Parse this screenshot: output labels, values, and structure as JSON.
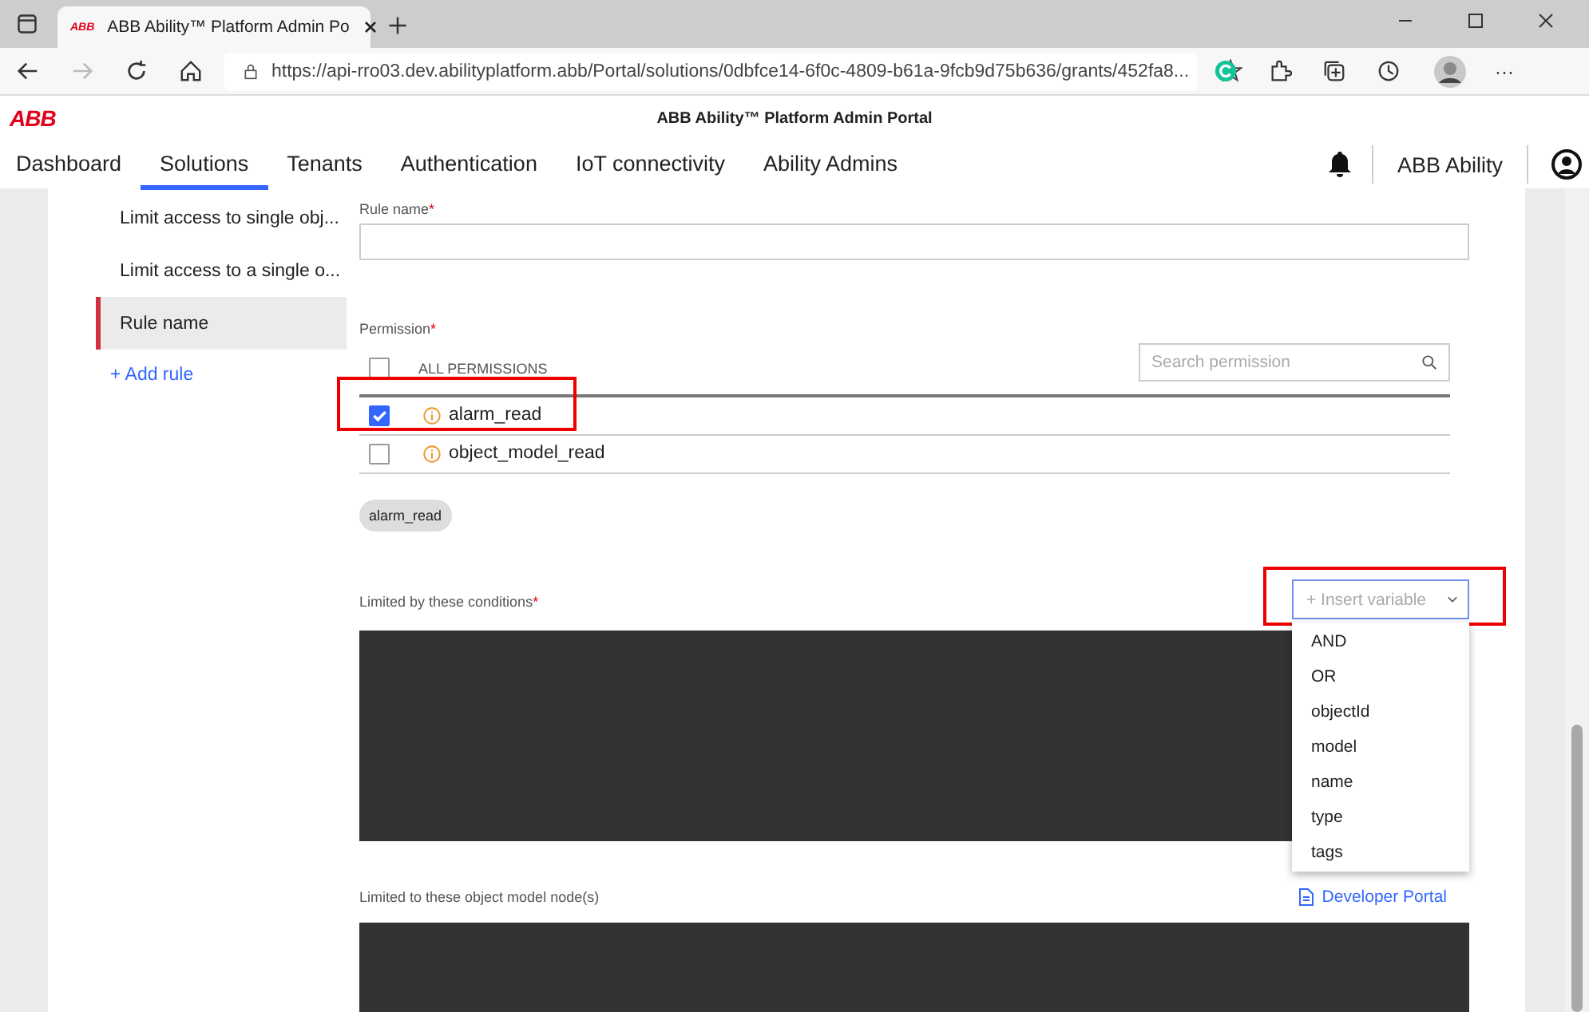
{
  "browser": {
    "tab_title": "ABB Ability™ Platform Admin Po",
    "tab_logo": "ABB",
    "url": "https://api-rro03.dev.abilityplatform.abb/Portal/solutions/0dbfce14-6f0c-4809-b61a-9fcb9d75b636/grants/452fa8...",
    "menu": "···"
  },
  "header": {
    "logo": "ABB",
    "title": "ABB Ability™ Platform Admin Portal",
    "tenant": "ABB Ability"
  },
  "nav": [
    {
      "label": "Dashboard",
      "selected": false
    },
    {
      "label": "Solutions",
      "selected": true
    },
    {
      "label": "Tenants",
      "selected": false
    },
    {
      "label": "Authentication",
      "selected": false
    },
    {
      "label": "IoT connectivity",
      "selected": false
    },
    {
      "label": "Ability Admins",
      "selected": false
    }
  ],
  "sidebar": {
    "items": [
      {
        "label": "Limit access to single obj...",
        "selected": false
      },
      {
        "label": "Limit access to a single o...",
        "selected": false
      },
      {
        "label": "Rule name",
        "selected": true
      }
    ],
    "add_rule": "+ Add rule"
  },
  "form": {
    "rule_name": {
      "label": "Rule name",
      "required_mark": "*"
    },
    "permission": {
      "label": "Permission",
      "required_mark": "*",
      "search_placeholder": "Search permission",
      "all_label": "ALL PERMISSIONS",
      "all_checked": false,
      "items": [
        {
          "name": "alarm_read",
          "checked": true,
          "highlighted": true
        },
        {
          "name": "object_model_read",
          "checked": false,
          "highlighted": false
        }
      ],
      "chips": [
        "alarm_read"
      ]
    },
    "conditions": {
      "label": "Limited by these conditions",
      "required_mark": "*",
      "insert_variable": {
        "label": "+ Insert variable",
        "highlighted": true,
        "expanded": true,
        "options": [
          "AND",
          "OR",
          "objectId",
          "model",
          "name",
          "type",
          "tags"
        ]
      }
    },
    "nodes": {
      "label": "Limited to these object model node(s)",
      "link": "Developer Portal"
    }
  }
}
